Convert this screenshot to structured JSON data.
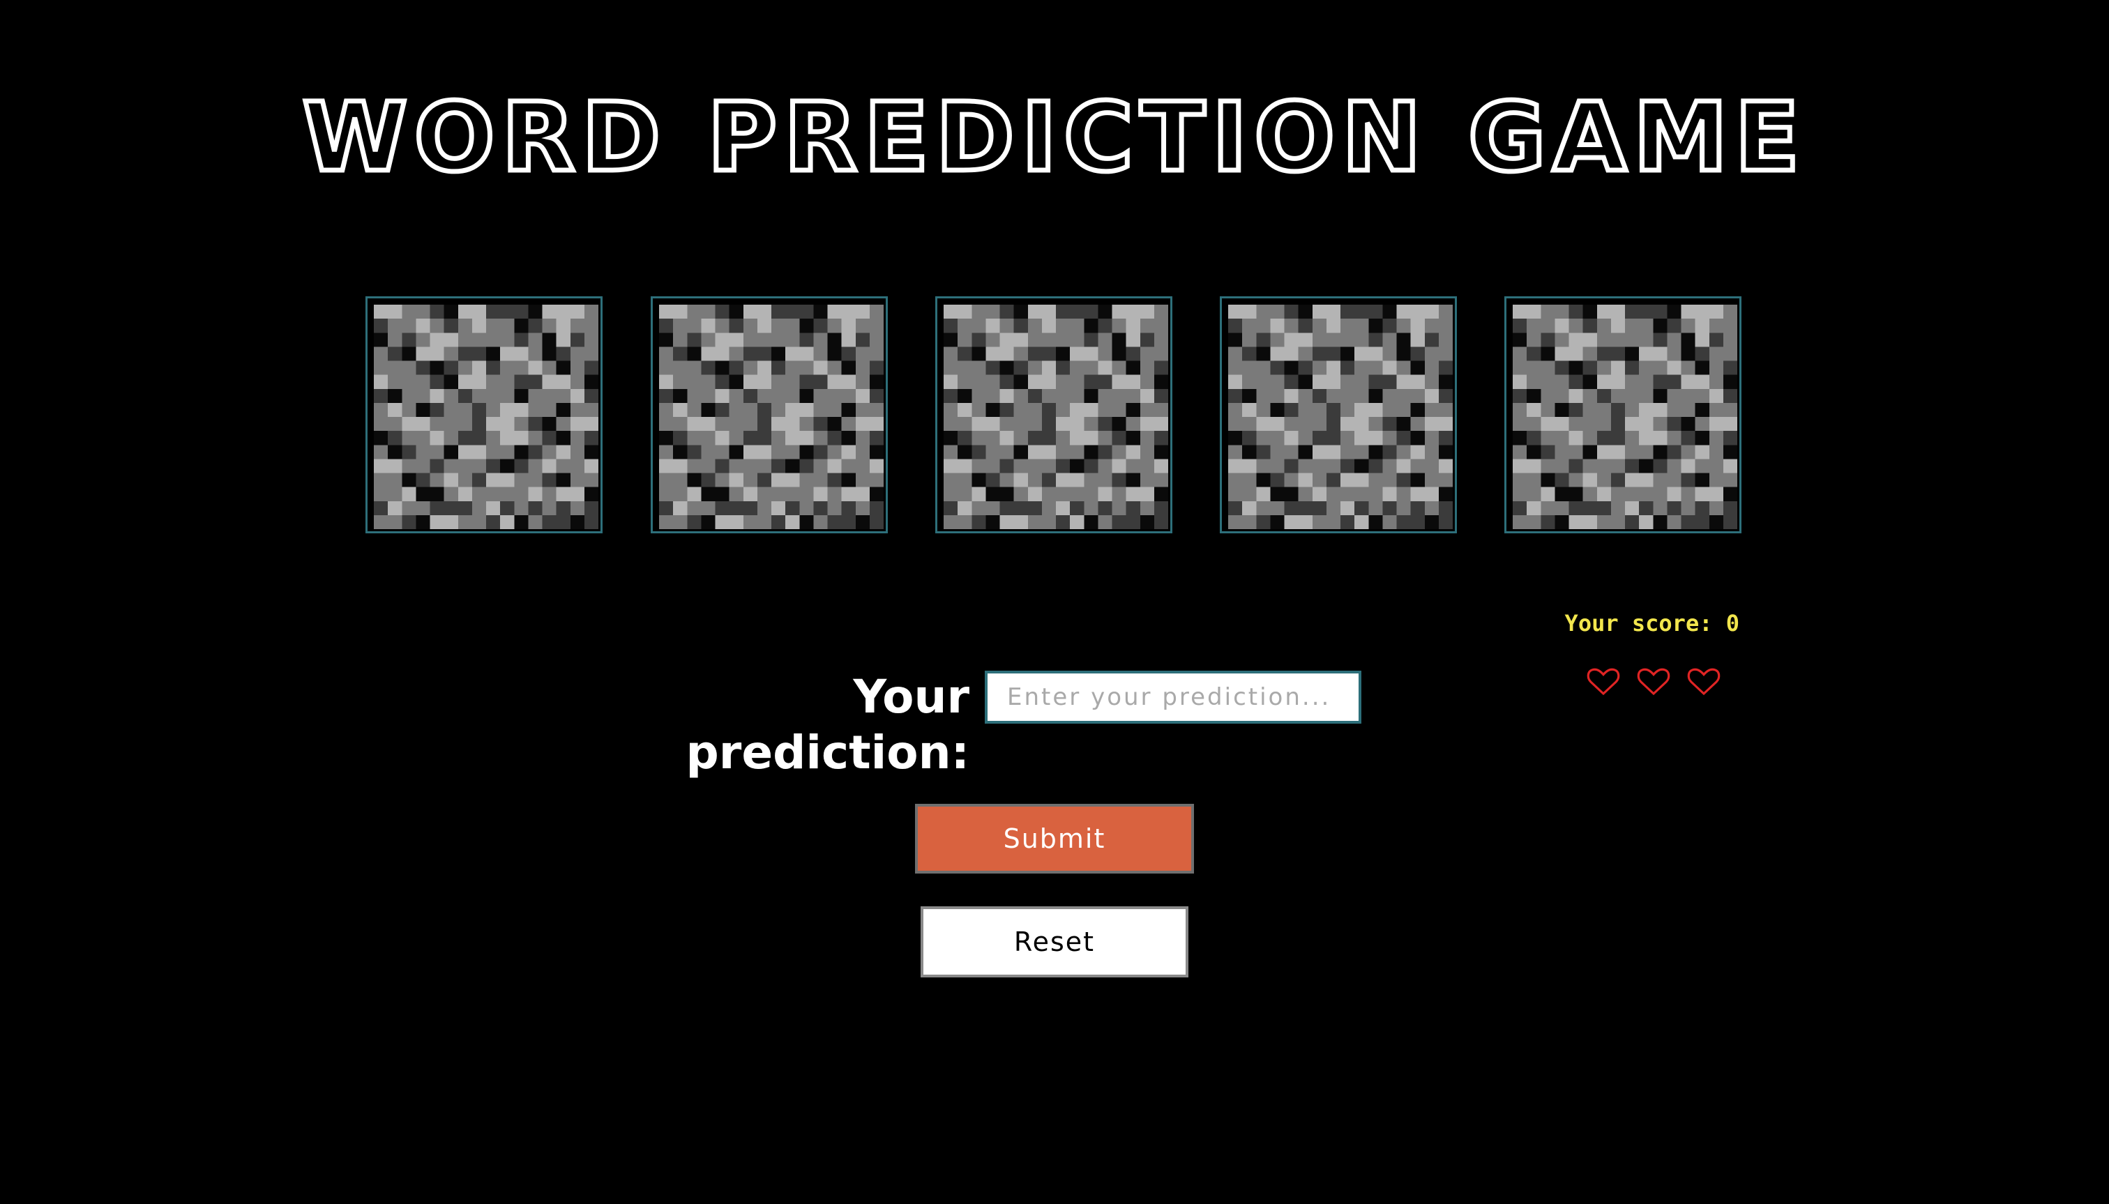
{
  "title": "WORD PREDICTION GAME",
  "tiles": [
    {
      "icon": "cobblestone-block-icon"
    },
    {
      "icon": "cobblestone-block-icon"
    },
    {
      "icon": "cobblestone-block-icon"
    },
    {
      "icon": "cobblestone-block-icon"
    },
    {
      "icon": "cobblestone-block-icon"
    }
  ],
  "score": {
    "text": "Your score: 0",
    "lives": 3,
    "heart_icon": "heart-outline-icon"
  },
  "prediction": {
    "label": "Your prediction:",
    "value": "",
    "placeholder": "Enter your prediction..."
  },
  "buttons": {
    "submit_label": "Submit",
    "reset_label": "Reset"
  },
  "colors": {
    "background": "#000000",
    "title": "#ffffff",
    "tile_border": "#2d6f7a",
    "score": "#f2e64d",
    "heart": "#e02424",
    "submit_bg": "#d9623f",
    "reset_bg": "#ffffff"
  }
}
